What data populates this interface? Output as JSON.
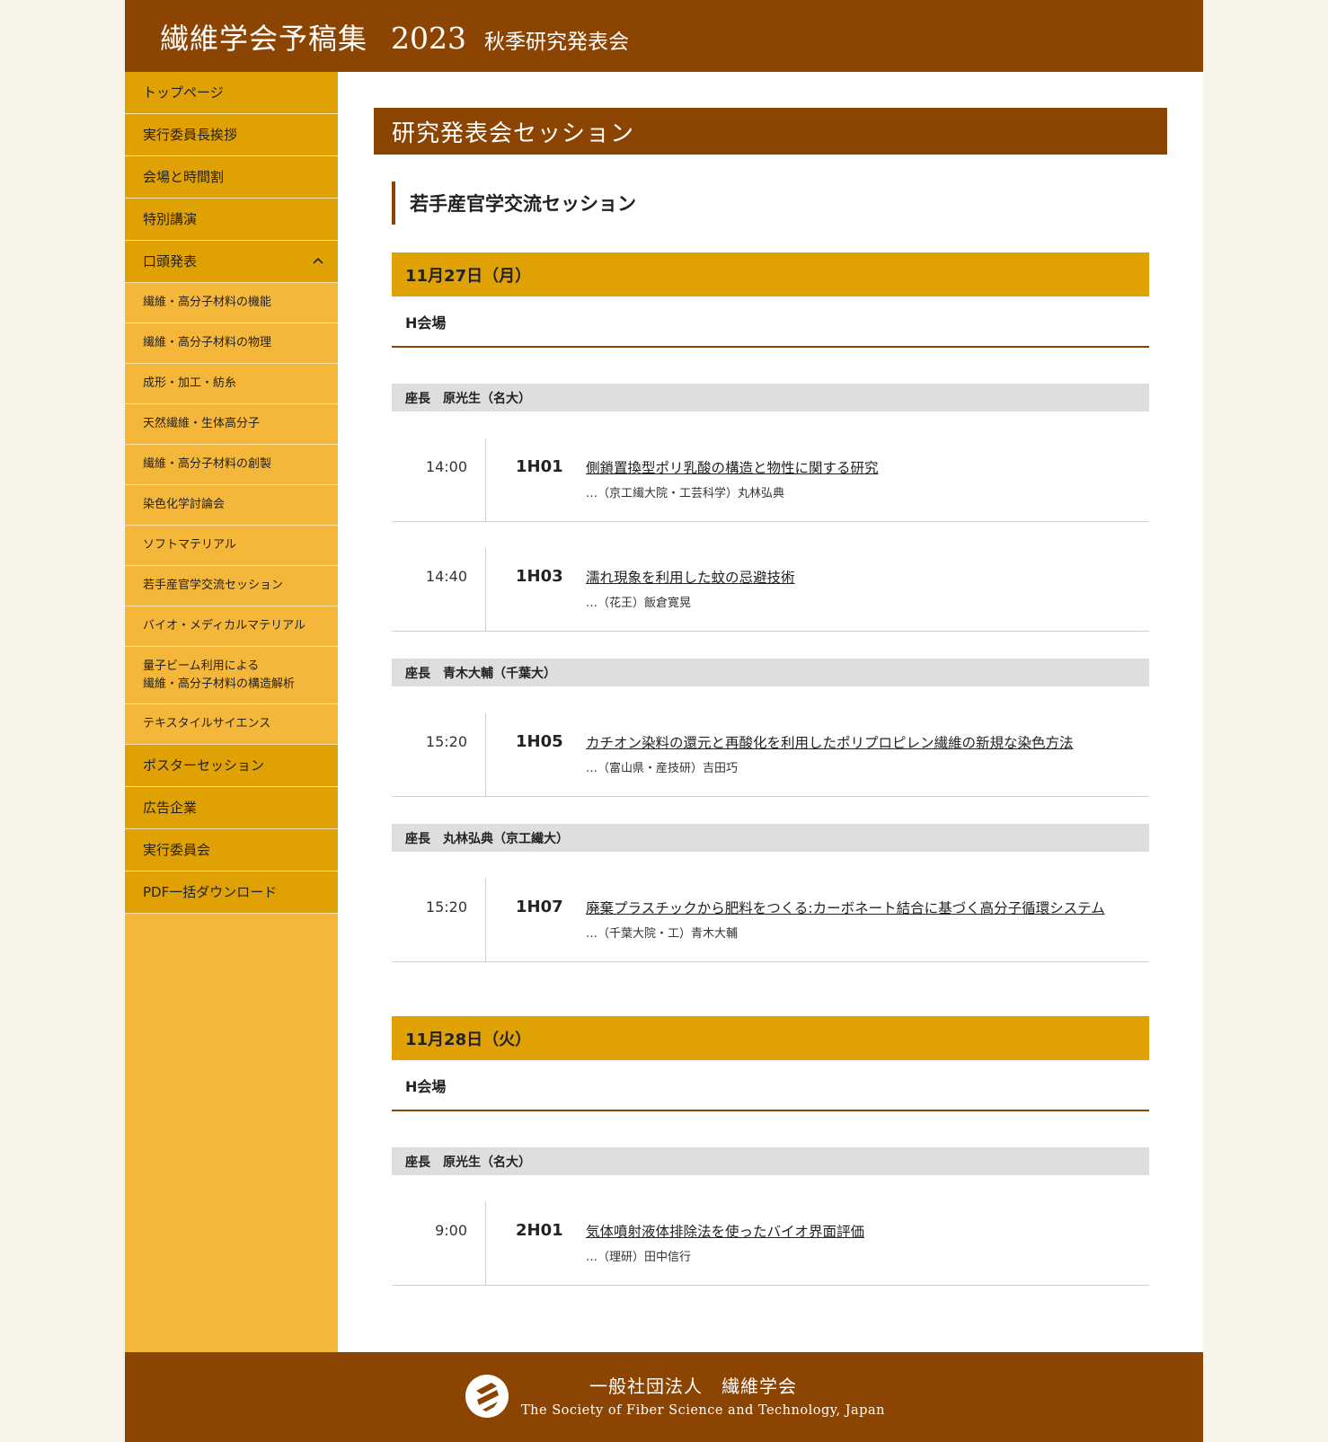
{
  "header": {
    "title": "繊維学会予稿集",
    "year": "2023",
    "subtitle": "秋季研究発表会"
  },
  "sidebar": {
    "items": [
      {
        "label": "トップページ",
        "type": "main"
      },
      {
        "label": "実行委員長挨拶",
        "type": "main"
      },
      {
        "label": "会場と時間割",
        "type": "main"
      },
      {
        "label": "特別講演",
        "type": "main"
      },
      {
        "label": "口頭発表",
        "type": "main",
        "expanded": true
      },
      {
        "label": "繊維・高分子材料の機能",
        "type": "sub"
      },
      {
        "label": "繊維・高分子材料の物理",
        "type": "sub"
      },
      {
        "label": "成形・加工・紡糸",
        "type": "sub"
      },
      {
        "label": "天然繊維・生体高分子",
        "type": "sub"
      },
      {
        "label": "繊維・高分子材料の創製",
        "type": "sub"
      },
      {
        "label": "染色化学討論会",
        "type": "sub"
      },
      {
        "label": "ソフトマテリアル",
        "type": "sub"
      },
      {
        "label": "若手産官学交流セッション",
        "type": "sub"
      },
      {
        "label": "バイオ・メディカルマテリアル",
        "type": "sub"
      },
      {
        "label": "量子ビーム利用による\n繊維・高分子材料の構造解析",
        "type": "sub"
      },
      {
        "label": "テキスタイルサイエンス",
        "type": "sub"
      },
      {
        "label": "ポスターセッション",
        "type": "main"
      },
      {
        "label": "広告企業",
        "type": "main"
      },
      {
        "label": "実行委員会",
        "type": "main"
      },
      {
        "label": "PDF一括ダウンロード",
        "type": "main"
      }
    ]
  },
  "main": {
    "section_title": "研究発表会セッション",
    "session_title": "若手産官学交流セッション",
    "days": [
      {
        "date": "11月27日（月）",
        "venue": "H会場",
        "blocks": [
          {
            "chair": "座長　原光生（名大）",
            "entries": [
              {
                "time": "14:00",
                "code": "1H01",
                "title": "側鎖置換型ポリ乳酸の構造と物性に関する研究",
                "author": "…（京工繊大院・工芸科学）丸林弘典"
              },
              {
                "time": "14:40",
                "code": "1H03",
                "title": "濡れ現象を利用した蚊の忌避技術",
                "author": "…（花王）飯倉寛晃"
              }
            ]
          },
          {
            "chair": "座長　青木大輔（千葉大）",
            "entries": [
              {
                "time": "15:20",
                "code": "1H05",
                "title": "カチオン染料の還元と再酸化を利用したポリプロピレン繊維の新規な染色方法",
                "author": "…（富山県・産技研）吉田巧"
              }
            ]
          },
          {
            "chair": "座長　丸林弘典（京工繊大）",
            "entries": [
              {
                "time": "15:20",
                "code": "1H07",
                "title": "廃棄プラスチックから肥料をつくる:カーボネート結合に基づく高分子循環システム",
                "author": "…（千葉大院・工）青木大輔"
              }
            ]
          }
        ]
      },
      {
        "date": "11月28日（火）",
        "venue": "H会場",
        "blocks": [
          {
            "chair": "座長　原光生（名大）",
            "entries": [
              {
                "time": "9:00",
                "code": "2H01",
                "title": "気体噴射液体排除法を使ったバイオ界面評価",
                "author": "…（理研）田中信行"
              }
            ]
          }
        ]
      }
    ]
  },
  "footer": {
    "org_jp": "一般社団法人　繊維学会",
    "org_en": "The Society of Fiber Science and Technology, Japan"
  },
  "colors": {
    "brown": "#8c4403",
    "gold": "#e0a104",
    "light_gold": "#f5b73a",
    "chair_gray": "#dedede",
    "page_bg": "#f8f4ea"
  }
}
